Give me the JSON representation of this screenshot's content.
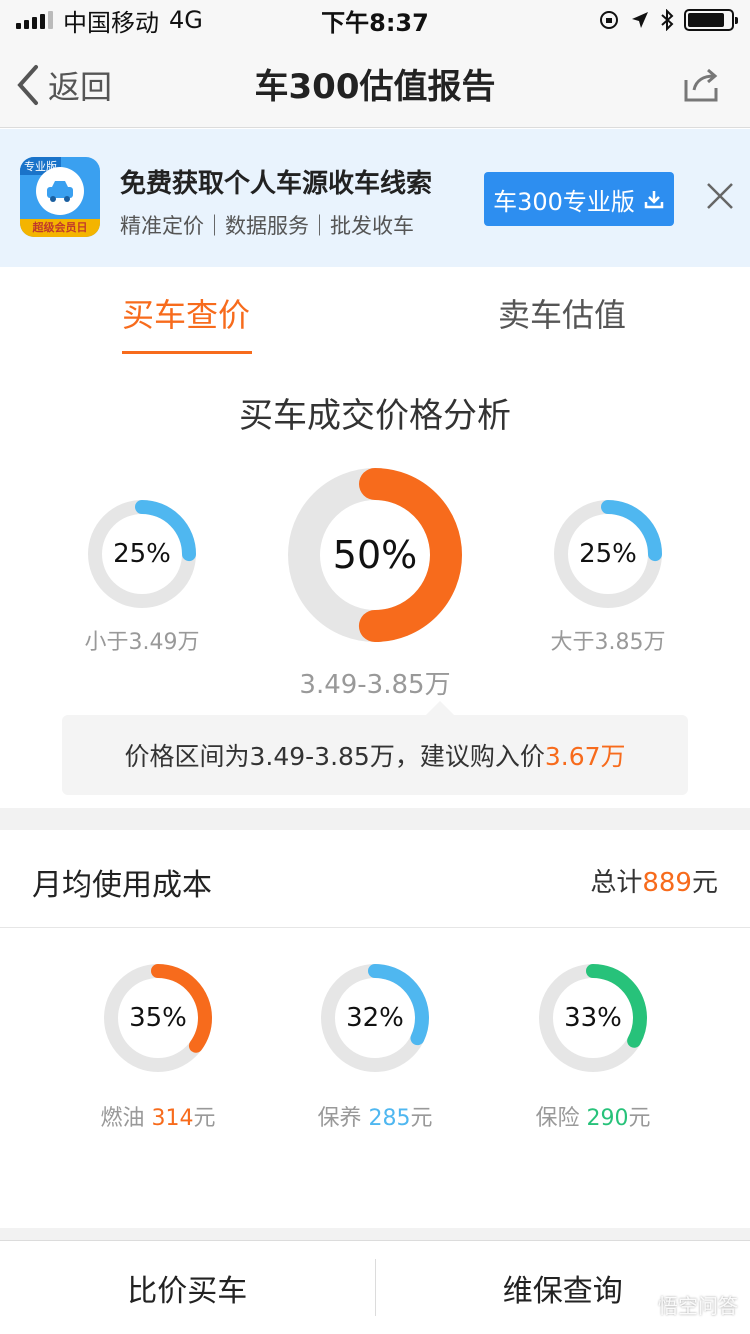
{
  "status_bar": {
    "carrier": "中国移动",
    "network": "4G",
    "time": "下午8:37"
  },
  "nav": {
    "back_label": "返回",
    "title": "车300估值报告"
  },
  "banner": {
    "app_badge": "专业版",
    "app_strip": "超级会员日",
    "title": "免费获取个人车源收车线索",
    "subtitle": "精准定价｜数据服务｜批发收车",
    "button_label": "车300专业版"
  },
  "tabs": {
    "buy": "买车查价",
    "sell": "卖车估值"
  },
  "price_analysis": {
    "title": "买车成交价格分析",
    "left": {
      "percent": "25%",
      "value": 25,
      "label": "小于3.49万",
      "color": "#4fb7f0"
    },
    "center": {
      "percent": "50%",
      "value": 50,
      "label": "3.49-3.85万",
      "color": "#f76b1c"
    },
    "right": {
      "percent": "25%",
      "value": 25,
      "label": "大于3.85万",
      "color": "#4fb7f0"
    },
    "tip_prefix": "价格区间为3.49-3.85万，建议购入价",
    "tip_price": "3.67万"
  },
  "monthly_cost": {
    "title": "月均使用成本",
    "total_prefix": "总计",
    "total_value": "889",
    "total_unit": "元",
    "items": [
      {
        "percent": "35%",
        "value": 35,
        "name": "燃油",
        "amount": "314",
        "unit": "元",
        "color": "#f76b1c"
      },
      {
        "percent": "32%",
        "value": 32,
        "name": "保养",
        "amount": "285",
        "unit": "元",
        "color": "#4fb7f0"
      },
      {
        "percent": "33%",
        "value": 33,
        "name": "保险",
        "amount": "290",
        "unit": "元",
        "color": "#27c27a"
      }
    ]
  },
  "bottom_bar": {
    "compare": "比价买车",
    "maintenance": "维保查询"
  },
  "watermark": "悟空问答"
}
